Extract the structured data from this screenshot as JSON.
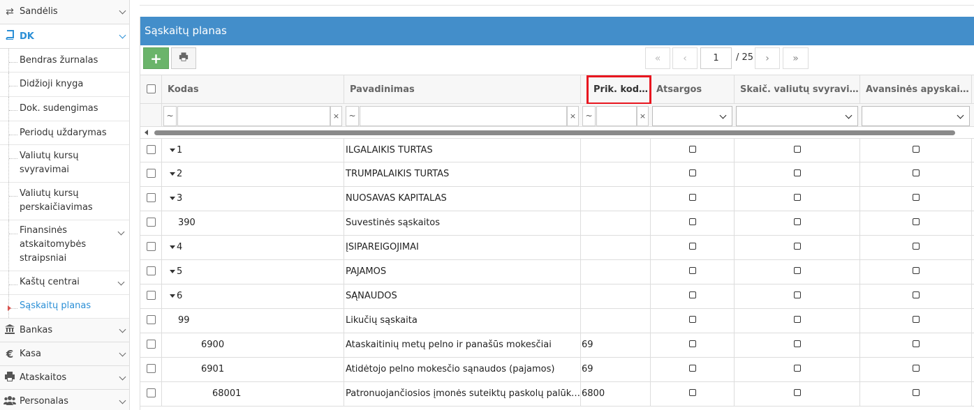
{
  "sidebar": {
    "top_items": [
      {
        "label": "Sandėlis",
        "icon": "arrows-exchange-icon"
      },
      {
        "label": "DK",
        "icon": "book-icon"
      }
    ],
    "sub_items": [
      {
        "label": "Bendras žurnalas"
      },
      {
        "label": "Didžioji knyga"
      },
      {
        "label": "Dok. sudengimas"
      },
      {
        "label": "Periodų uždarymas"
      },
      {
        "label": "Valiutų kursų svyravimai"
      },
      {
        "label": "Valiutų kursų perskaičiavimas"
      },
      {
        "label": "Finansinės atskaitomybės straipsniai"
      },
      {
        "label": "Kaštų centrai"
      },
      {
        "label": "Sąskaitų planas"
      }
    ],
    "bottom_items": [
      {
        "label": "Bankas",
        "icon": "bank-icon"
      },
      {
        "label": "Kasa",
        "icon": "euro-icon"
      },
      {
        "label": "Ataskaitos",
        "icon": "printer-icon"
      },
      {
        "label": "Personalas",
        "icon": "users-icon"
      }
    ]
  },
  "panel": {
    "title": "Sąskaitų planas"
  },
  "toolbar": {
    "add_label": "+",
    "pager": {
      "first": "«",
      "prev": "‹",
      "current_page": "1",
      "total": "/ 25",
      "next": "›",
      "last": "»"
    }
  },
  "grid": {
    "columns": [
      {
        "label": "Kodas"
      },
      {
        "label": "Pavadinimas"
      },
      {
        "label": "Prik. kodas"
      },
      {
        "label": "Atsargos"
      },
      {
        "label": "Skaič. valiutų svyravim..."
      },
      {
        "label": "Avansinės apyskaitos"
      }
    ],
    "filter_op": "~",
    "filter_clear": "×",
    "rows": [
      {
        "kodas": "1",
        "pavadinimas": "ILGALAIKIS TURTAS",
        "prik": "",
        "expandable": true,
        "level": 0
      },
      {
        "kodas": "2",
        "pavadinimas": "TRUMPALAIKIS TURTAS",
        "prik": "",
        "expandable": true,
        "level": 0
      },
      {
        "kodas": "3",
        "pavadinimas": "NUOSAVAS KAPITALAS",
        "prik": "",
        "expandable": true,
        "level": 0
      },
      {
        "kodas": "390",
        "pavadinimas": "Suvestinės sąskaitos",
        "prik": "",
        "expandable": false,
        "level": 1
      },
      {
        "kodas": "4",
        "pavadinimas": "ĮSIPAREIGOJIMAI",
        "prik": "",
        "expandable": true,
        "level": 0
      },
      {
        "kodas": "5",
        "pavadinimas": "PAJAMOS",
        "prik": "",
        "expandable": true,
        "level": 0
      },
      {
        "kodas": "6",
        "pavadinimas": "SĄNAUDOS",
        "prik": "",
        "expandable": true,
        "level": 0
      },
      {
        "kodas": "99",
        "pavadinimas": "Likučių sąskaita",
        "prik": "",
        "expandable": false,
        "level": 1
      },
      {
        "kodas": "6900",
        "pavadinimas": "Ataskaitinių metų pelno ir panašūs mokesčiai",
        "prik": "69",
        "expandable": false,
        "level": 2
      },
      {
        "kodas": "6901",
        "pavadinimas": "Atidėtojo pelno mokesčio sąnaudos (pajamos)",
        "prik": "69",
        "expandable": false,
        "level": 2
      },
      {
        "kodas": "68001",
        "pavadinimas": "Patronuojančiosios įmonės suteiktų paskolų palūkan...",
        "prik": "6800",
        "expandable": false,
        "level": 3
      }
    ]
  }
}
